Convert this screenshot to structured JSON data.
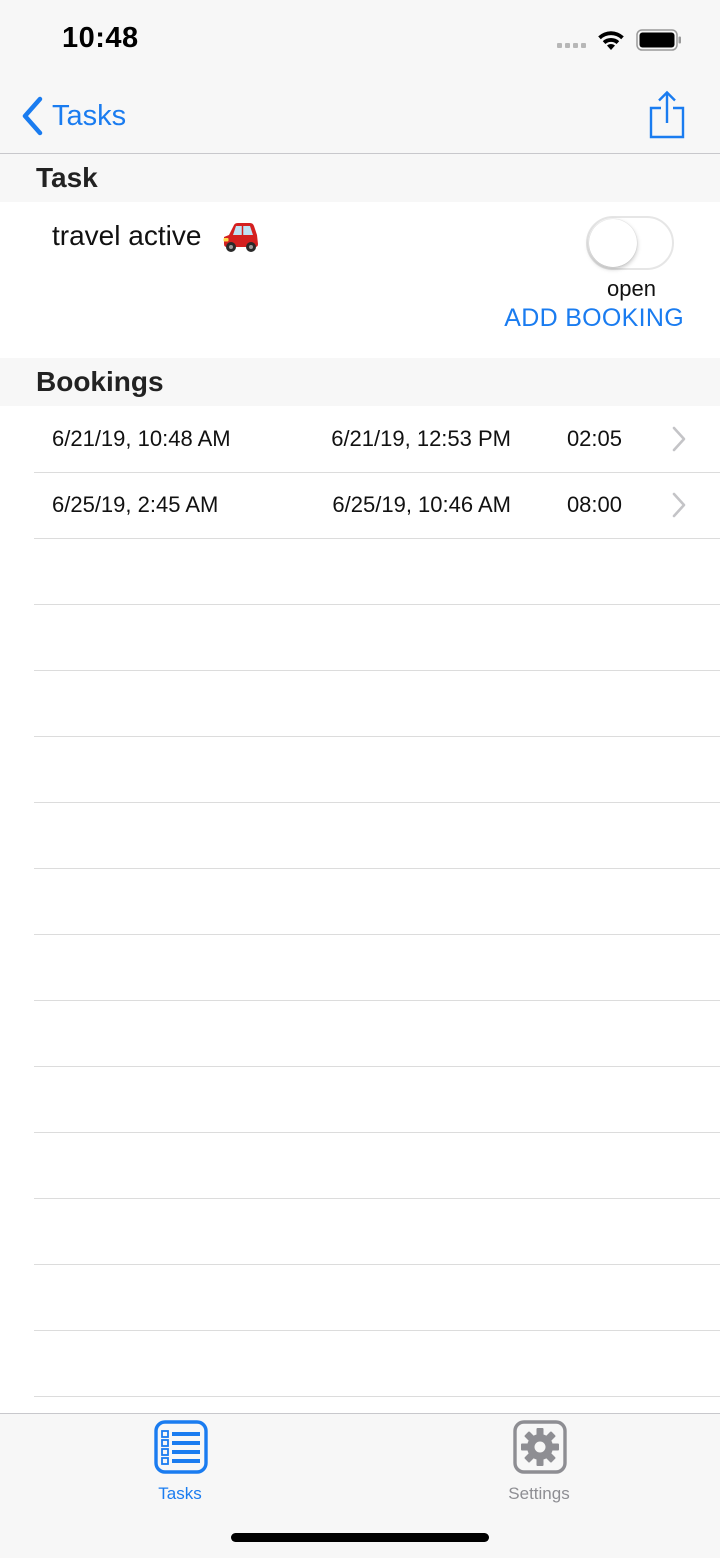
{
  "status_bar": {
    "time": "10:48"
  },
  "nav": {
    "back_label": "Tasks"
  },
  "sections": {
    "task_header": "Task",
    "bookings_header": "Bookings"
  },
  "task": {
    "name": "travel active",
    "icon": "car-icon",
    "toggle_on": false,
    "status": "open",
    "add_booking_label": "ADD BOOKING"
  },
  "bookings": [
    {
      "start": "6/21/19, 10:48 AM",
      "end": "6/21/19, 12:53 PM",
      "duration": "02:05"
    },
    {
      "start": "6/25/19, 2:45 AM",
      "end": "6/25/19, 10:46 AM",
      "duration": "08:00"
    }
  ],
  "tab_bar": {
    "items": [
      {
        "label": "Tasks",
        "icon": "list-icon",
        "selected": true
      },
      {
        "label": "Settings",
        "icon": "gear-icon",
        "selected": false
      }
    ]
  },
  "colors": {
    "accent": "#1a7cf0",
    "inactive": "#8e8e93",
    "section_bg": "#f7f7f7",
    "separator": "#dcdcdc"
  }
}
